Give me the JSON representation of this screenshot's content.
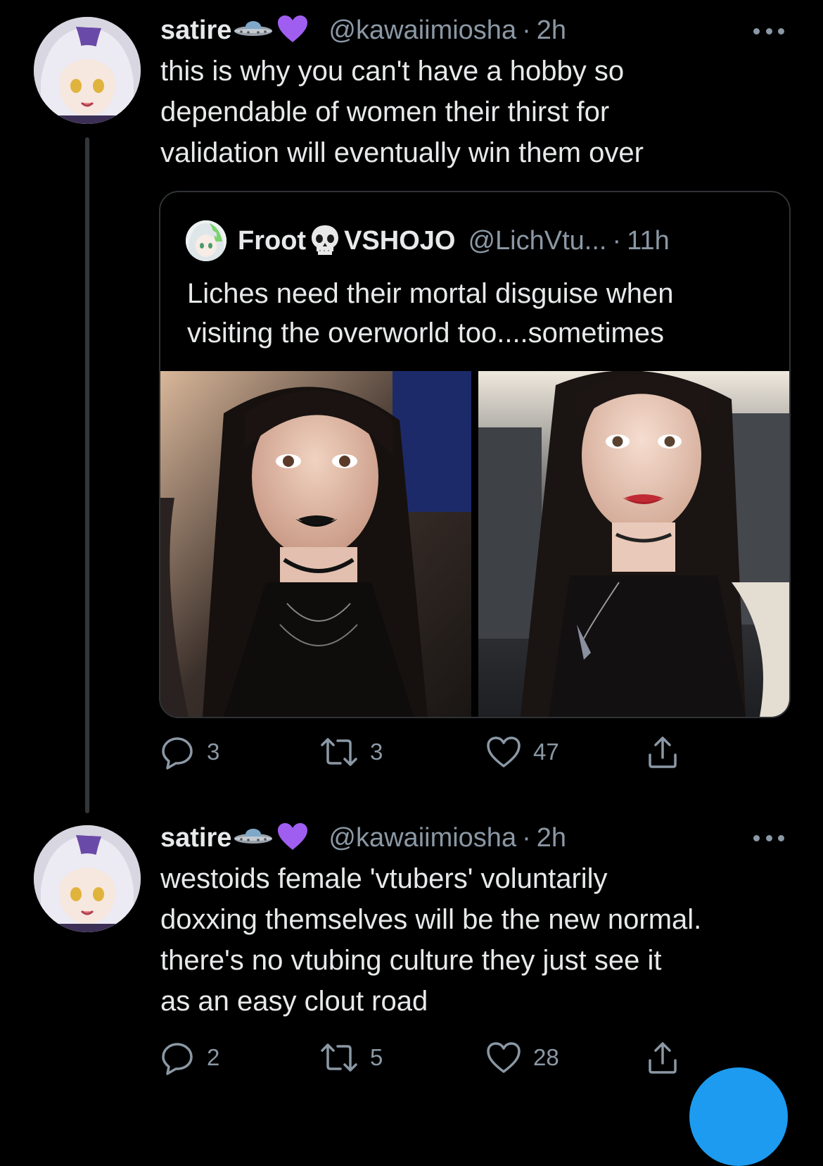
{
  "thread": [
    {
      "author": {
        "name": "satire",
        "emojis": [
          "🛸",
          "💜"
        ],
        "handle": "@kawaiimiosha",
        "time": "2h"
      },
      "text": "this is why you can't have a hobby so\ndependable of women their thirst for\nvalidation will eventually win them over",
      "quote": {
        "author": {
          "name_part1": "Froot",
          "emoji": "💀",
          "name_part2": "VSHOJO",
          "handle": "@LichVtu...",
          "time": "11h"
        },
        "text": "Liches need their mortal disguise when\nvisiting the overworld too....sometimes",
        "media_count": 2
      },
      "actions": {
        "replies": "3",
        "retweets": "3",
        "likes": "47"
      }
    },
    {
      "author": {
        "name": "satire",
        "emojis": [
          "🛸",
          "💜"
        ],
        "handle": "@kawaiimiosha",
        "time": "2h"
      },
      "text": "westoids female 'vtubers' voluntarily\ndoxxing themselves will be the new normal.\nthere's no vtubing culture they just see it\nas an easy clout road",
      "actions": {
        "replies": "2",
        "retweets": "5",
        "likes": "28"
      }
    }
  ],
  "separator": "·",
  "colors": {
    "background": "#000000",
    "text_primary": "#e7e9ea",
    "text_secondary": "#8b98a5",
    "border": "#2f3336",
    "accent": "#1d9bf0"
  },
  "icons": [
    "reply-icon",
    "retweet-icon",
    "like-icon",
    "share-icon",
    "more-icon",
    "ufo-emoji",
    "purple-heart-emoji",
    "skull-emoji"
  ]
}
